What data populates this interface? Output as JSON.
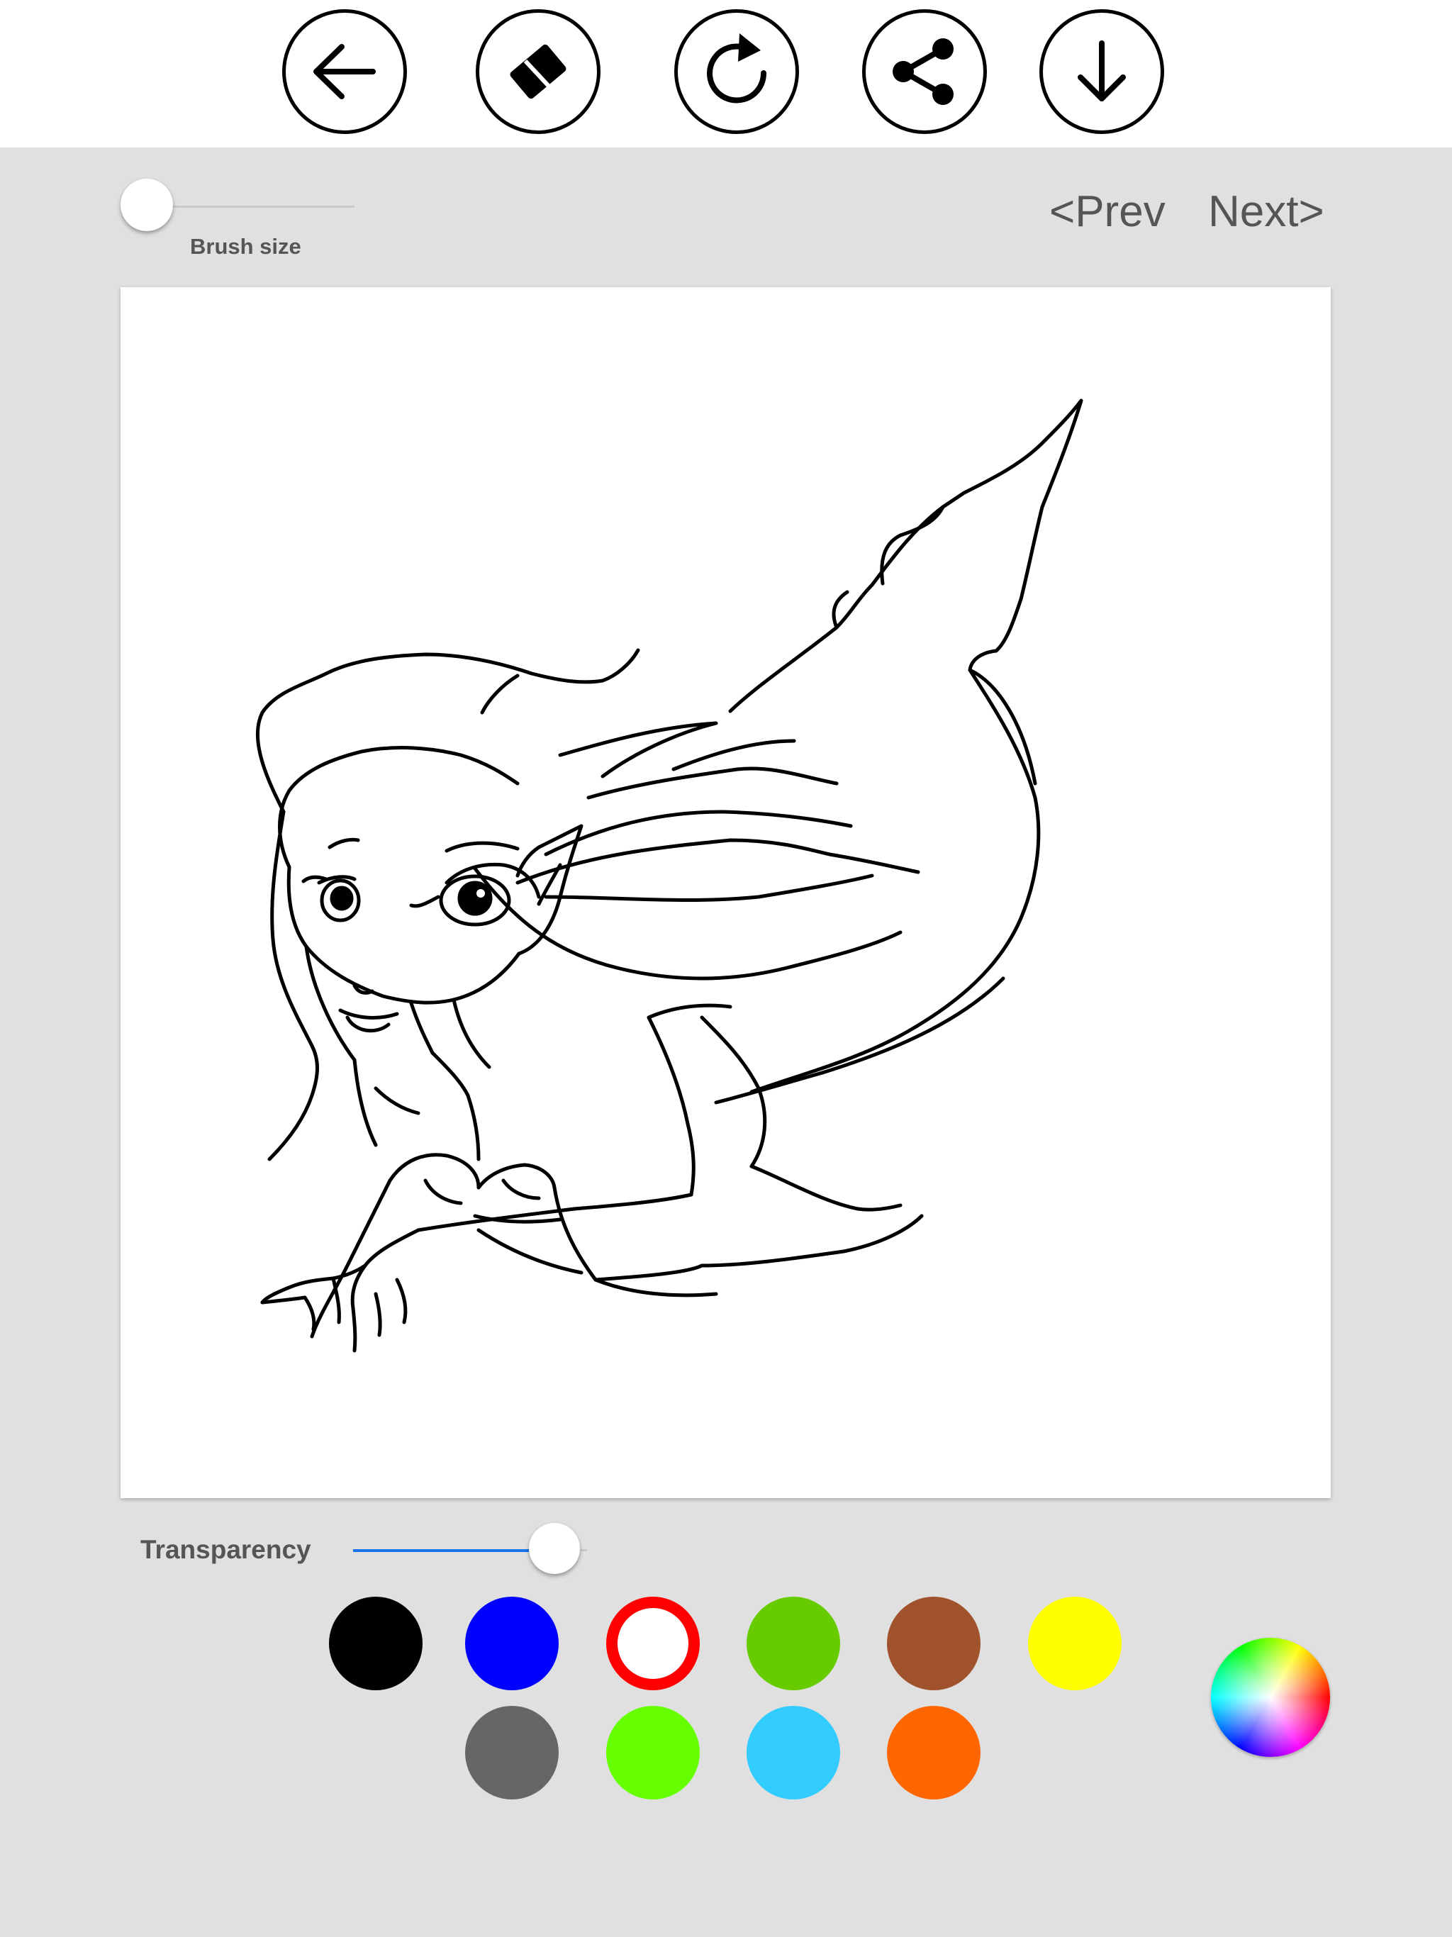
{
  "toolbar": {
    "buttons": [
      {
        "name": "back",
        "icon": "arrow-left-icon"
      },
      {
        "name": "eraser",
        "icon": "eraser-icon"
      },
      {
        "name": "redo",
        "icon": "rotate-clockwise-icon"
      },
      {
        "name": "share",
        "icon": "share-icon"
      },
      {
        "name": "download",
        "icon": "arrow-down-icon"
      }
    ]
  },
  "brush": {
    "label": "Brush size",
    "value": 0.0
  },
  "navigation": {
    "prev_label": "<Prev",
    "next_label": "Next>"
  },
  "canvas": {
    "picture": "mermaid-outline"
  },
  "transparency": {
    "label": "Transparency",
    "value": 0.86,
    "accent_color": "#1a73e8"
  },
  "palette": {
    "selected": "#ffffff",
    "row1": [
      "#000000",
      "#0000ff",
      "#ffffff",
      "#66cc00",
      "#a0522d",
      "#ffff00"
    ],
    "row2": [
      "#666666",
      "#66ff00",
      "#33ccff",
      "#ff6600"
    ],
    "custom_picker_icon": "color-wheel-icon"
  }
}
